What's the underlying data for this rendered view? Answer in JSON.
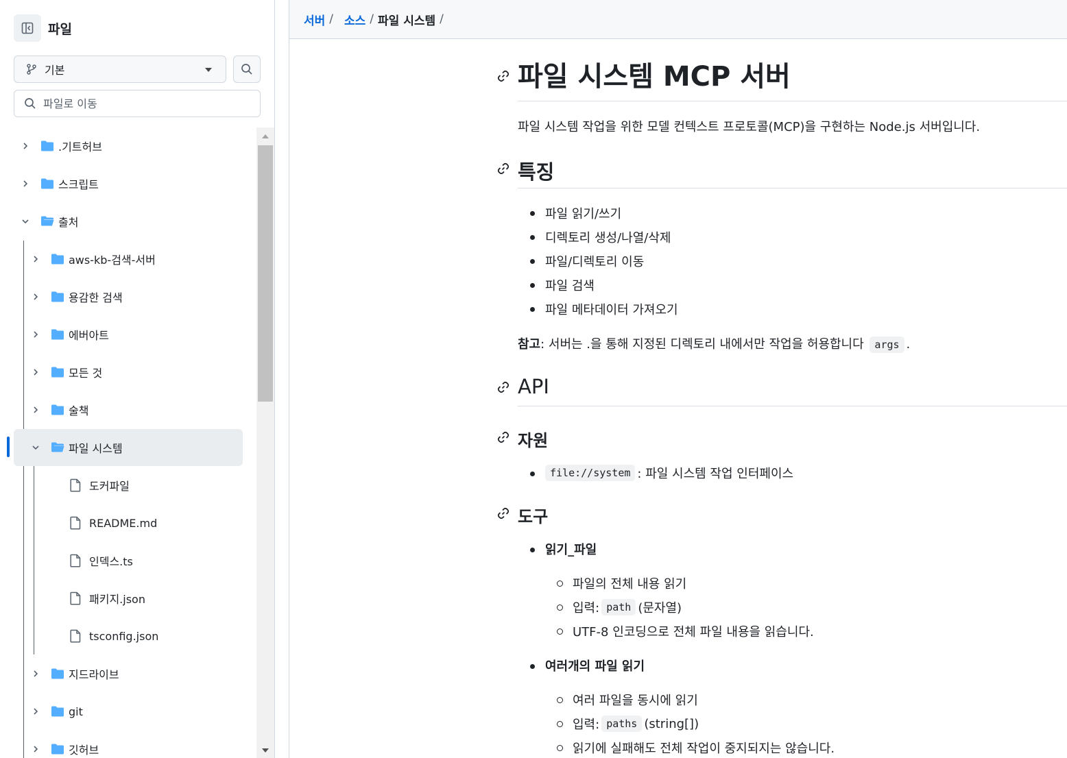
{
  "sidebar": {
    "title": "파일",
    "branch_label": "기본",
    "goto_placeholder": "파일로 이동",
    "tree": [
      {
        "label": ".기트허브",
        "type": "folder",
        "expanded": false
      },
      {
        "label": "스크립트",
        "type": "folder",
        "expanded": false
      },
      {
        "label": "출처",
        "type": "folder",
        "expanded": true
      },
      {
        "label": "aws-kb-검색-서버",
        "type": "folder",
        "expanded": false
      },
      {
        "label": "용감한 검색",
        "type": "folder",
        "expanded": false
      },
      {
        "label": "에버아트",
        "type": "folder",
        "expanded": false
      },
      {
        "label": "모든 것",
        "type": "folder",
        "expanded": false
      },
      {
        "label": "술책",
        "type": "folder",
        "expanded": false
      },
      {
        "label": "파일 시스템",
        "type": "folder",
        "expanded": true,
        "selected": true
      },
      {
        "label": "도커파일",
        "type": "file"
      },
      {
        "label": "README.md",
        "type": "file"
      },
      {
        "label": "인덱스.ts",
        "type": "file"
      },
      {
        "label": "패키지.json",
        "type": "file"
      },
      {
        "label": "tsconfig.json",
        "type": "file"
      },
      {
        "label": "지드라이브",
        "type": "folder",
        "expanded": false
      },
      {
        "label": "git",
        "type": "folder",
        "expanded": false
      },
      {
        "label": "깃허브",
        "type": "folder",
        "expanded": false
      }
    ]
  },
  "breadcrumb": {
    "link1": "서버",
    "link2": "소스",
    "current": "파일 시스템",
    "sep": "/"
  },
  "doc": {
    "title": "파일 시스템 MCP 서버",
    "intro": "파일 시스템 작업을 위한 모델 컨텍스트 프로토콜(MCP)을 구현하는 Node.js 서버입니다.",
    "features_heading": "특징",
    "features": [
      "파일 읽기/쓰기",
      "디렉토리 생성/나열/삭제",
      "파일/디렉토리 이동",
      "파일 검색",
      "파일 메타데이터 가져오기"
    ],
    "note_label": "참고",
    "note_text": ": 서버는 .을 통해 지정된 디렉토리 내에서만 작업을 허용합니다",
    "note_code": "args",
    "note_end": ".",
    "api_heading": "API",
    "resources_heading": "자원",
    "resource_code": "file://system",
    "resource_text": ": 파일 시스템 작업 인터페이스",
    "tools_heading": "도구",
    "tool1": {
      "name": "읽기_파일",
      "desc": "파일의 전체 내용 읽기",
      "input_label": "입력:",
      "input_code": "path",
      "input_type": "(문자열)",
      "note": "UTF-8 인코딩으로 전체 파일 내용을 읽습니다."
    },
    "tool2": {
      "name": "여러개의 파일 읽기",
      "desc": "여러 파일을 동시에 읽기",
      "input_label": "입력:",
      "input_code": "paths",
      "input_type": "(string[])",
      "note": "읽기에 실패해도 전체 작업이 중지되지는 않습니다."
    }
  },
  "colors": {
    "folder": "#54aeff",
    "link": "#0969da",
    "selection": "#0969da"
  }
}
